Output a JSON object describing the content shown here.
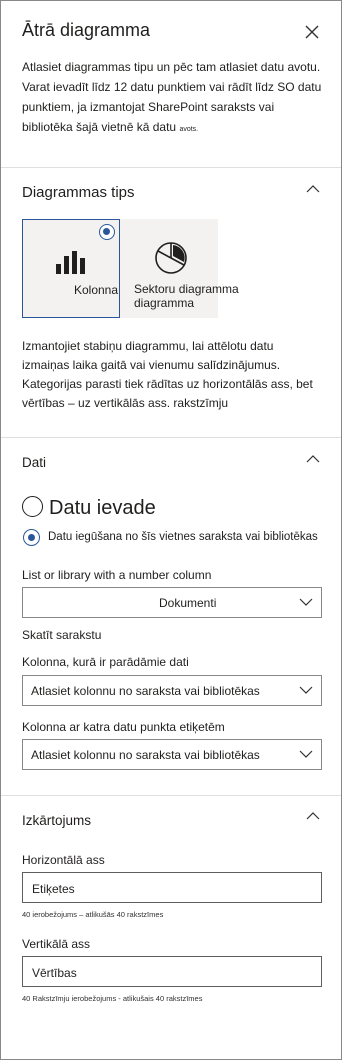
{
  "panel": {
    "title": "Ātrā diagramma",
    "intro": "Atlasiet diagrammas tipu un pēc tam atlasiet datu avotu. Varat ievadīt līdz 12 datu punktiem vai rādīt līdz SO datu punktiem, ja izmantojat SharePoint saraksts vai bibliotēka šajā vietnē kā datu",
    "intro_small": "avots."
  },
  "chart_type": {
    "section_title": "Diagrammas tips",
    "options": [
      {
        "label": "Kolonna",
        "icon": "bar-chart-icon",
        "selected": true
      },
      {
        "label": "Sektoru diagramma diagramma",
        "icon": "pie-chart-icon",
        "selected": false
      }
    ],
    "description": "Izmantojiet stabiņu diagrammu, lai attēlotu datu izmaiņas laika gaitā vai vienumu salīdzinājumus. Kategorijas parasti tiek rādītas uz horizontālās ass, bet vērtības – uz vertikālās ass. rakstzīmju"
  },
  "data": {
    "section_title": "Dati",
    "radio_manual": "Datu ievade",
    "radio_list": "Datu iegūšana no šīs vietnes saraksta vai bibliotēkas",
    "list_label": "List or library with a number column",
    "list_value": "Dokumenti",
    "view_list": "Skatīt sarakstu",
    "column_label": "Kolonna, kurā ir parādāmie dati",
    "column_placeholder": "Atlasiet kolonnu no saraksta vai bibliotēkas",
    "label_column_label": "Kolonna ar katra datu punkta etiķetēm",
    "label_column_placeholder": "Atlasiet kolonnu no saraksta vai bibliotēkas"
  },
  "layout": {
    "section_title": "Izkārtojums",
    "horizontal_label": "Horizontālā ass",
    "horizontal_value": "Etiķetes",
    "horizontal_hint": "40 ierobežojums – atlikušās 40 rakstzīmes",
    "vertical_label": "Vertikālā ass",
    "vertical_value": "Vērtības",
    "vertical_hint": "40 Rakstzīmju ierobežojums - atlikušais 40 rakstzīmes"
  },
  "colors": {
    "accent": "#2b579a",
    "divider": "#e1dfdd",
    "tile": "#f3f2f1"
  }
}
